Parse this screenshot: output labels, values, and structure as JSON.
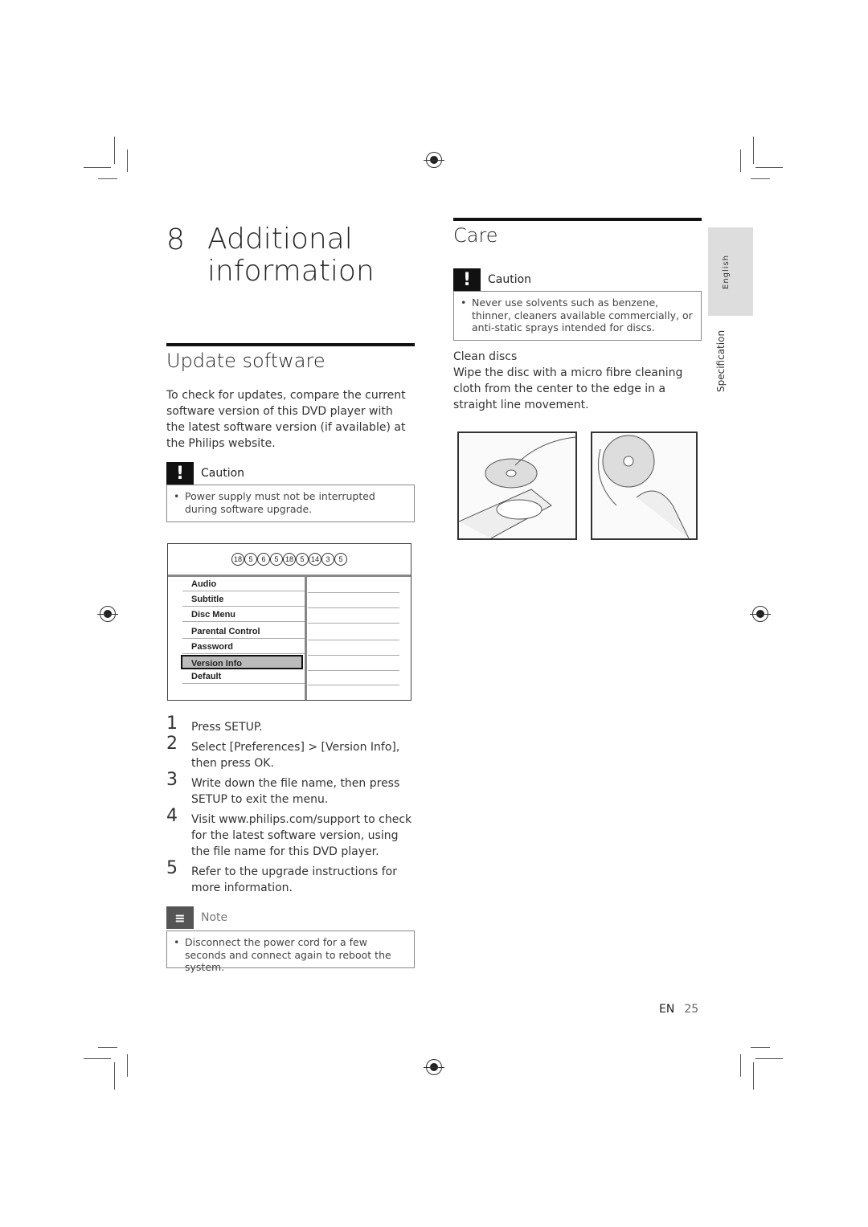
{
  "chapter": {
    "number": "8",
    "title_line1": "Additional",
    "title_line2": "information"
  },
  "update": {
    "heading": "Update software",
    "intro": "To check for updates, compare the current software version of this DVD player with the latest software version (if available) at the Philips website.",
    "caution_label": "Caution",
    "caution_item": "Power supply must not be interrupted during software upgrade.",
    "menu": {
      "header_symbols": [
        "18",
        "5",
        "6",
        "5",
        "18",
        "5",
        "14",
        "3",
        "5"
      ],
      "items": [
        "Audio",
        "Subtitle",
        "Disc Menu",
        "Parental Control",
        "Password",
        "Version Info",
        "Default"
      ],
      "selected": "Version Info"
    },
    "steps": [
      {
        "n": "1",
        "text": "Press SETUP."
      },
      {
        "n": "2",
        "text": "Select [Preferences] > [Version Info], then press OK."
      },
      {
        "n": "3",
        "text": "Write down the file name, then press SETUP to exit the menu."
      },
      {
        "n": "4",
        "text": "Visit www.philips.com/support to check for the latest software version, using the file name for this DVD player."
      },
      {
        "n": "5",
        "text": "Refer to the upgrade instructions for more information."
      }
    ],
    "note_label": "Note",
    "note_item": "Disconnect the power cord for a few seconds and connect again to reboot the system."
  },
  "care": {
    "heading": "Care",
    "caution_label": "Caution",
    "caution_item": "Never use solvents such as benzene, thinner, cleaners available commercially, or anti-static sprays intended for discs.",
    "sub": "Clean discs",
    "text": "Wipe the disc with a micro fibre cleaning cloth from the center to the edge in a straight line movement."
  },
  "side_tabs": {
    "language": "English",
    "section": "Specification"
  },
  "footer": {
    "lang": "EN",
    "page": "25"
  }
}
